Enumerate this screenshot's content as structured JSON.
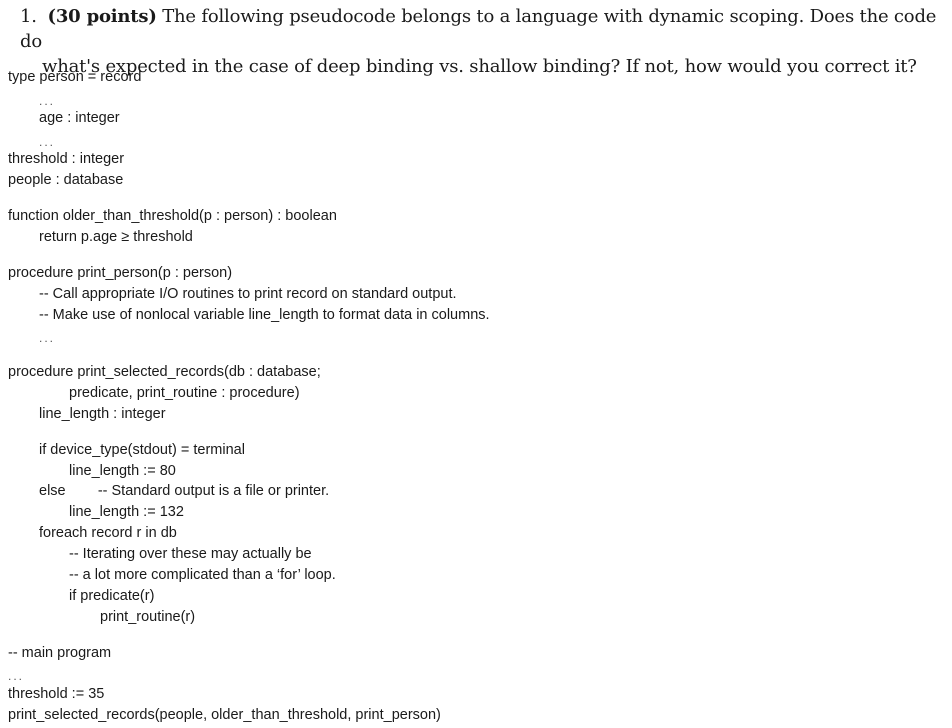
{
  "question": {
    "number": "1.",
    "points": "(30 points)",
    "text_line1": "The following pseudocode belongs to a language with dynamic scoping. Does the code do",
    "text_line2": "what's expected in the case of deep binding vs. shallow binding? If not, how would you correct it?"
  },
  "code": {
    "lines": [
      {
        "text": "type person = record",
        "indent": 0
      },
      {
        "text": "...",
        "indent": 1
      },
      {
        "text": "age : integer",
        "indent": 1
      },
      {
        "text": "...",
        "indent": 1
      },
      {
        "text": "threshold : integer",
        "indent": 0
      },
      {
        "text": "people : database",
        "indent": 0
      },
      {
        "text": "function older_than_threshold(p : person) : boolean",
        "indent": 0
      },
      {
        "text": "return p.age ≥ threshold",
        "indent": 1
      },
      {
        "text": "procedure print_person(p : person)",
        "indent": 0
      },
      {
        "text": "-- Call appropriate I/O routines to print record on standard output.",
        "indent": 1
      },
      {
        "text": "-- Make use of nonlocal variable line_length to format data in columns.",
        "indent": 1
      },
      {
        "text": "...",
        "indent": 1
      },
      {
        "text": "procedure print_selected_records(db : database;",
        "indent": 0
      },
      {
        "text": "predicate, print_routine : procedure)",
        "indent": 2
      },
      {
        "text": "line_length : integer",
        "indent": 1
      },
      {
        "text": "if device_type(stdout) = terminal",
        "indent": 1
      },
      {
        "text": "line_length := 80",
        "indent": 2
      },
      {
        "text": "else        -- Standard output is a file or printer.",
        "indent": 1
      },
      {
        "text": "line_length := 132",
        "indent": 2
      },
      {
        "text": "foreach record r in db",
        "indent": 1
      },
      {
        "text": "-- Iterating over these may actually be",
        "indent": 2
      },
      {
        "text": "-- a lot more complicated than a ‘for’ loop.",
        "indent": 2
      },
      {
        "text": "if predicate(r)",
        "indent": 2
      },
      {
        "text": "print_routine(r)",
        "indent": 3
      },
      {
        "text": "-- main program",
        "indent": 0
      },
      {
        "text": "...",
        "indent": 0
      },
      {
        "text": "threshold := 35",
        "indent": 0
      },
      {
        "text": "print_selected_records(people, older_than_threshold, print_person)",
        "indent": 0
      }
    ]
  }
}
